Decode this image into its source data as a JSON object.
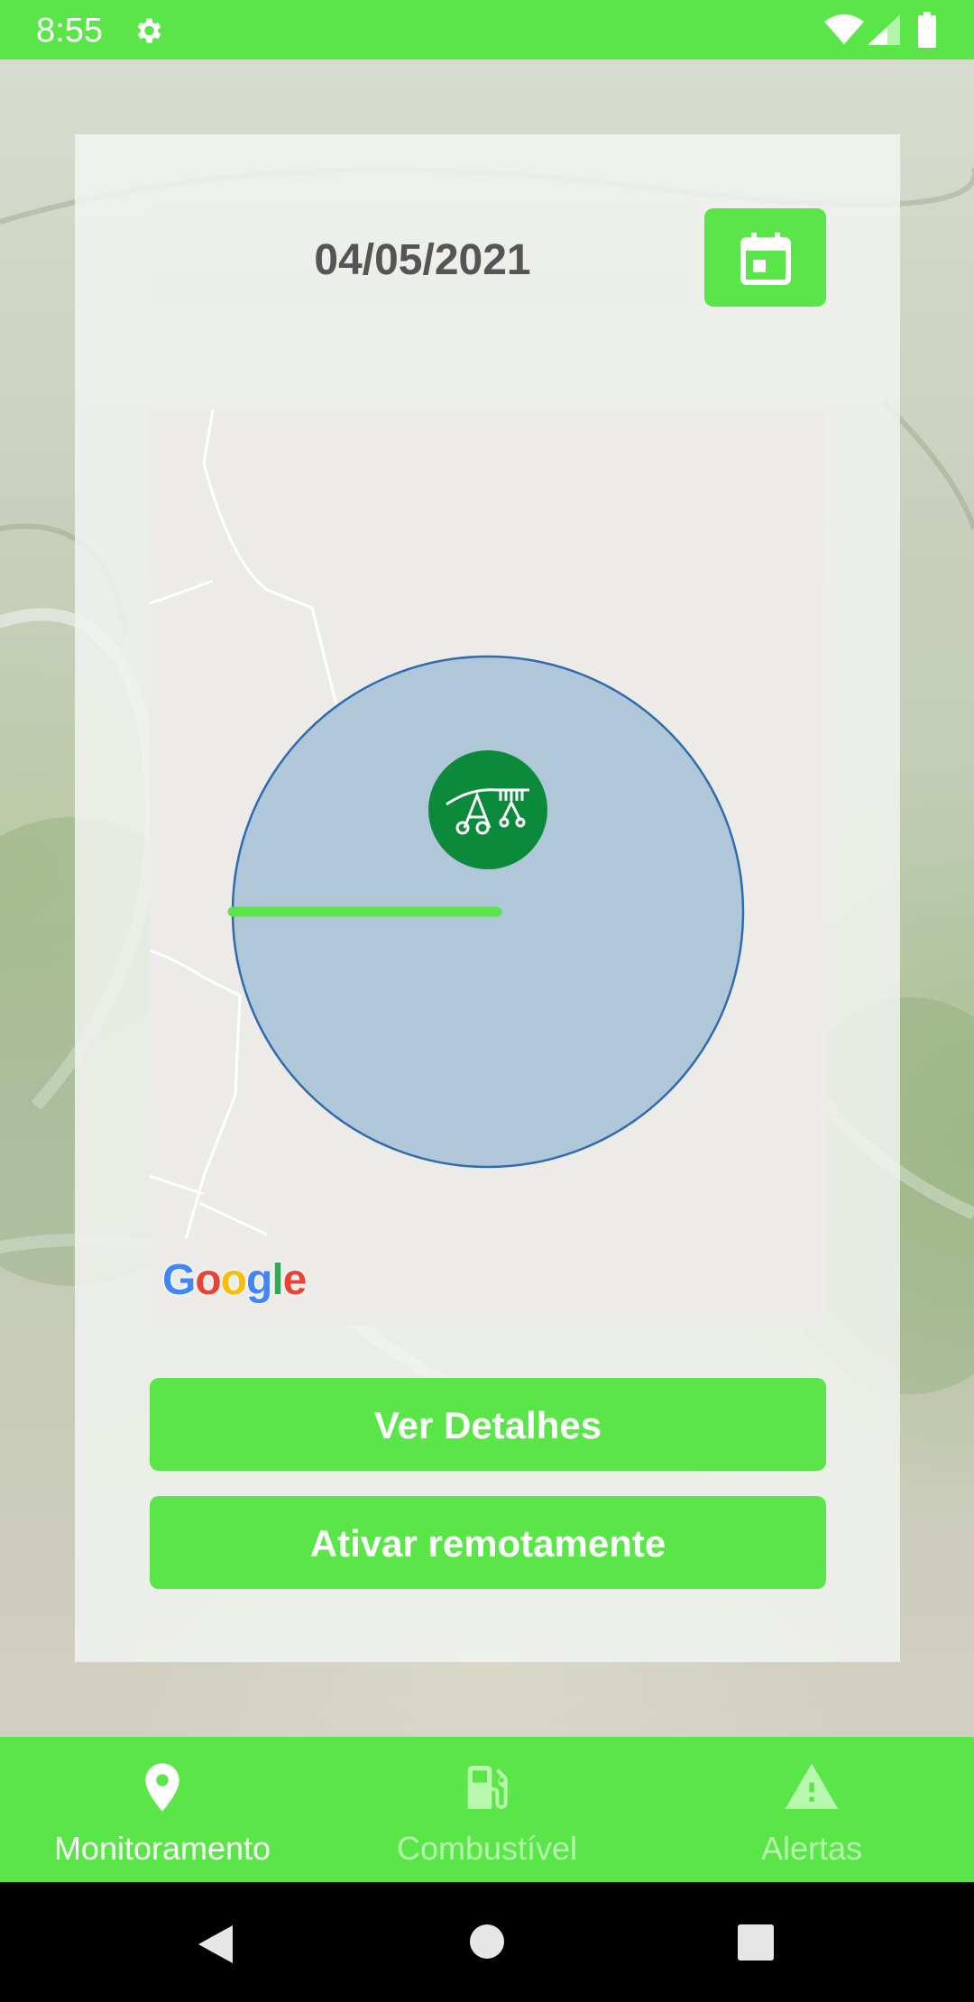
{
  "status_bar": {
    "time": "8:55",
    "icons": [
      "gear-icon",
      "wifi-icon",
      "cell-signal-icon",
      "battery-icon"
    ]
  },
  "monitor": {
    "date": "04/05/2021",
    "calendar_icon": "calendar-icon",
    "map": {
      "attribution": "Google",
      "marker_icon": "center-pivot-irrigation-icon",
      "pivot_fill_color": "#b0c7d9",
      "pivot_border_color": "#2f6bb0",
      "pivot_arm_color": "#5ae548",
      "marker_color": "#0c8a3c"
    },
    "buttons": {
      "details": "Ver Detalhes",
      "remote": "Ativar remotamente"
    }
  },
  "bottom_nav": {
    "items": [
      {
        "label": "Monitoramento",
        "icon": "map-pin-icon",
        "active": true
      },
      {
        "label": "Combustível",
        "icon": "fuel-pump-icon",
        "active": false
      },
      {
        "label": "Alertas",
        "icon": "warning-icon",
        "active": false
      }
    ]
  },
  "system_nav": {
    "icons": [
      "back-icon",
      "home-icon",
      "recents-icon"
    ]
  },
  "colors": {
    "accent": "#5ae548",
    "nav_inactive": "#b7f7ae",
    "date_text": "#555555"
  }
}
